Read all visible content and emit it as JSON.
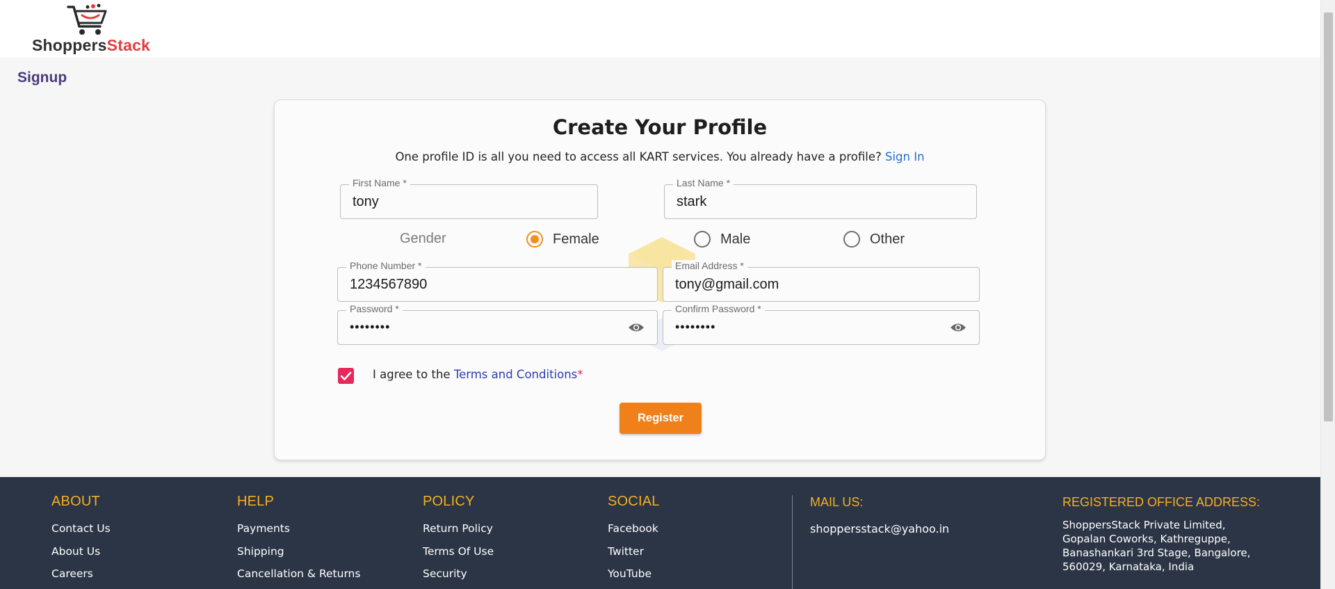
{
  "header": {
    "logo_part1": "Shoppers",
    "logo_part2": "Stack",
    "logo_colors": {
      "dark": "#2f2f2f",
      "red": "#e0403f"
    }
  },
  "page": {
    "title": "Signup"
  },
  "form": {
    "heading": "Create Your Profile",
    "subtitle": "One profile ID is all you need to access all KART services. You already have a profile?",
    "sign_in_link": "Sign In",
    "first_name": {
      "label": "First Name *",
      "value": "tony"
    },
    "last_name": {
      "label": "Last Name *",
      "value": "stark"
    },
    "gender": {
      "label": "Gender",
      "options": [
        "Female",
        "Male",
        "Other"
      ],
      "selected": "Female"
    },
    "phone": {
      "label": "Phone Number *",
      "value": "1234567890"
    },
    "email": {
      "label": "Email Address *",
      "value": "tony@gmail.com"
    },
    "password": {
      "label": "Password *",
      "value": "••••••••"
    },
    "confirm_password": {
      "label": "Confirm Password *",
      "value": "••••••••"
    },
    "terms": {
      "prefix": "I agree to the",
      "link": "Terms and Conditions",
      "required_mark": "*",
      "checked": true
    },
    "register_label": "Register",
    "accent_color": "#f0801a"
  },
  "footer": {
    "about": {
      "heading": "ABOUT",
      "items": [
        "Contact Us",
        "About Us",
        "Careers"
      ]
    },
    "help": {
      "heading": "HELP",
      "items": [
        "Payments",
        "Shipping",
        "Cancellation & Returns"
      ]
    },
    "policy": {
      "heading": "POLICY",
      "items": [
        "Return Policy",
        "Terms Of Use",
        "Security"
      ]
    },
    "social": {
      "heading": "SOCIAL",
      "items": [
        "Facebook",
        "Twitter",
        "YouTube"
      ]
    },
    "mail": {
      "heading": "MAIL US:",
      "value": "shoppersstack@yahoo.in"
    },
    "address": {
      "heading": "REGISTERED OFFICE ADDRESS:",
      "lines": [
        "ShoppersStack Private Limited,",
        "Gopalan Coworks, Kathreguppe,",
        "Banashankari 3rd Stage, Bangalore,",
        "560029, Karnataka, India"
      ]
    },
    "background_color": "#2c3546",
    "heading_color": "#f4b021"
  }
}
